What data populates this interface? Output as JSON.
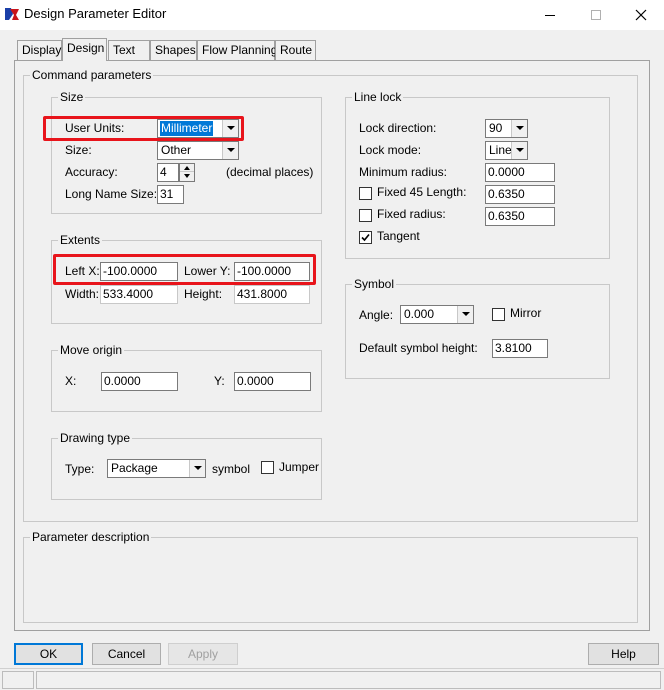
{
  "window": {
    "title": "Design Parameter Editor",
    "icon": "app-icon",
    "controls": [
      "minimize-icon",
      "maximize-icon",
      "close-icon"
    ]
  },
  "tabs": [
    "Display",
    "Design",
    "Text",
    "Shapes",
    "Flow Planning",
    "Route"
  ],
  "active_tab": "Design",
  "command_parameters": {
    "title": "Command parameters",
    "size": {
      "title": "Size",
      "user_units_label": "User Units:",
      "user_units_value": "Millimeter",
      "size_label": "Size:",
      "size_value": "Other",
      "accuracy_label": "Accuracy:",
      "accuracy_value": "4",
      "accuracy_suffix": "(decimal places)",
      "long_name_size_label": "Long Name Size:",
      "long_name_size_value": "31"
    },
    "extents": {
      "title": "Extents",
      "left_x_label": "Left X:",
      "left_x_value": "-100.0000",
      "lower_y_label": "Lower Y:",
      "lower_y_value": "-100.0000",
      "width_label": "Width:",
      "width_value": "533.4000",
      "height_label": "Height:",
      "height_value": "431.8000"
    },
    "move_origin": {
      "title": "Move origin",
      "x_label": "X:",
      "x_value": "0.0000",
      "y_label": "Y:",
      "y_value": "0.0000"
    },
    "drawing_type": {
      "title": "Drawing type",
      "type_label": "Type:",
      "type_value": "Package",
      "symbol_label": "symbol",
      "jumper_label": "Jumper",
      "jumper_checked": false
    },
    "line_lock": {
      "title": "Line lock",
      "lock_direction_label": "Lock direction:",
      "lock_direction_value": "90",
      "lock_mode_label": "Lock mode:",
      "lock_mode_value": "Line",
      "minimum_radius_label": "Minimum radius:",
      "minimum_radius_value": "0.0000",
      "fixed45_label": "Fixed 45 Length:",
      "fixed45_value": "0.6350",
      "fixed45_checked": false,
      "fixed_radius_label": "Fixed radius:",
      "fixed_radius_value": "0.6350",
      "fixed_radius_checked": false,
      "tangent_label": "Tangent",
      "tangent_checked": true
    },
    "symbol": {
      "title": "Symbol",
      "angle_label": "Angle:",
      "angle_value": "0.000",
      "mirror_label": "Mirror",
      "mirror_checked": false,
      "default_height_label": "Default symbol height:",
      "default_height_value": "3.8100"
    }
  },
  "parameter_description": {
    "title": "Parameter description",
    "text": ""
  },
  "buttons": {
    "ok": "OK",
    "cancel": "Cancel",
    "apply": "Apply",
    "help": "Help"
  },
  "colors": {
    "highlight_box": "#e8141b",
    "selection": "#0078d7",
    "dialog_bg": "#f0f0f0"
  }
}
